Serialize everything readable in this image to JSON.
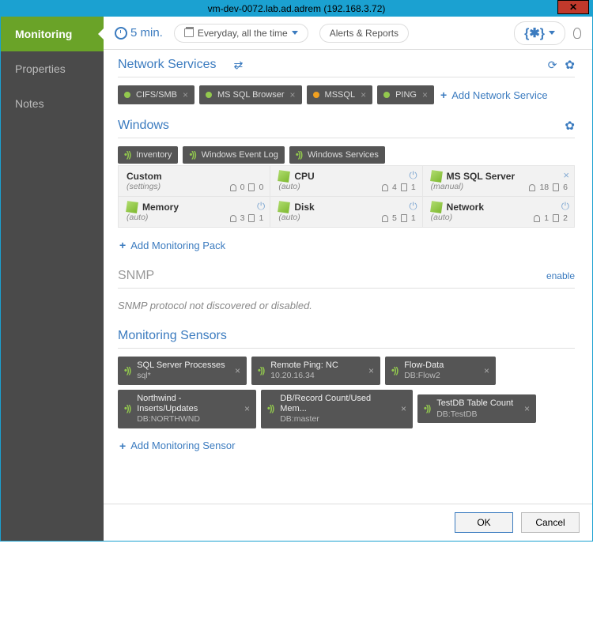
{
  "window": {
    "title": "vm-dev-0072.lab.ad.adrem (192.168.3.72)"
  },
  "sidebar": {
    "items": [
      {
        "label": "Monitoring",
        "active": true
      },
      {
        "label": "Properties",
        "active": false
      },
      {
        "label": "Notes",
        "active": false
      }
    ]
  },
  "toolbar": {
    "interval": "5 min.",
    "schedule": "Everyday, all the time",
    "alerts": "Alerts & Reports"
  },
  "sections": {
    "network_services": {
      "title": "Network Services",
      "chips": [
        {
          "label": "CIFS/SMB",
          "status": "green"
        },
        {
          "label": "MS SQL Browser",
          "status": "green"
        },
        {
          "label": "MSSQL",
          "status": "orange"
        },
        {
          "label": "PING",
          "status": "green"
        }
      ],
      "add": "Add Network Service"
    },
    "windows": {
      "title": "Windows",
      "top_chips": [
        {
          "label": "Inventory"
        },
        {
          "label": "Windows Event Log"
        },
        {
          "label": "Windows Services"
        }
      ],
      "packs": [
        {
          "title": "Custom",
          "sub": "(settings)",
          "alerts": 0,
          "reports": 0,
          "cube": false,
          "power": false,
          "close": false
        },
        {
          "title": "CPU",
          "sub": "(auto)",
          "alerts": 4,
          "reports": 1,
          "cube": true,
          "power": true,
          "close": false
        },
        {
          "title": "MS SQL Server",
          "sub": "(manual)",
          "alerts": 18,
          "reports": 6,
          "cube": true,
          "power": false,
          "close": true
        },
        {
          "title": "Memory",
          "sub": "(auto)",
          "alerts": 3,
          "reports": 1,
          "cube": true,
          "power": true,
          "close": false
        },
        {
          "title": "Disk",
          "sub": "(auto)",
          "alerts": 5,
          "reports": 1,
          "cube": true,
          "power": true,
          "close": false
        },
        {
          "title": "Network",
          "sub": "(auto)",
          "alerts": 1,
          "reports": 2,
          "cube": true,
          "power": true,
          "close": false
        }
      ],
      "add": "Add Monitoring Pack"
    },
    "snmp": {
      "title": "SNMP",
      "action": "enable",
      "note": "SNMP protocol not discovered or disabled."
    },
    "sensors": {
      "title": "Monitoring Sensors",
      "chips": [
        {
          "line1": "SQL Server Processes",
          "line2": "sql*"
        },
        {
          "line1": "Remote Ping: NC",
          "line2": "10.20.16.34"
        },
        {
          "line1": "Flow-Data",
          "line2": "DB:Flow2"
        },
        {
          "line1": "Northwind - Inserts/Updates",
          "line2": "DB:NORTHWND"
        },
        {
          "line1": "DB/Record Count/Used Mem...",
          "line2": "DB:master"
        },
        {
          "line1": "TestDB Table Count",
          "line2": "DB:TestDB"
        }
      ],
      "add": "Add Monitoring Sensor"
    }
  },
  "footer": {
    "ok": "OK",
    "cancel": "Cancel"
  }
}
